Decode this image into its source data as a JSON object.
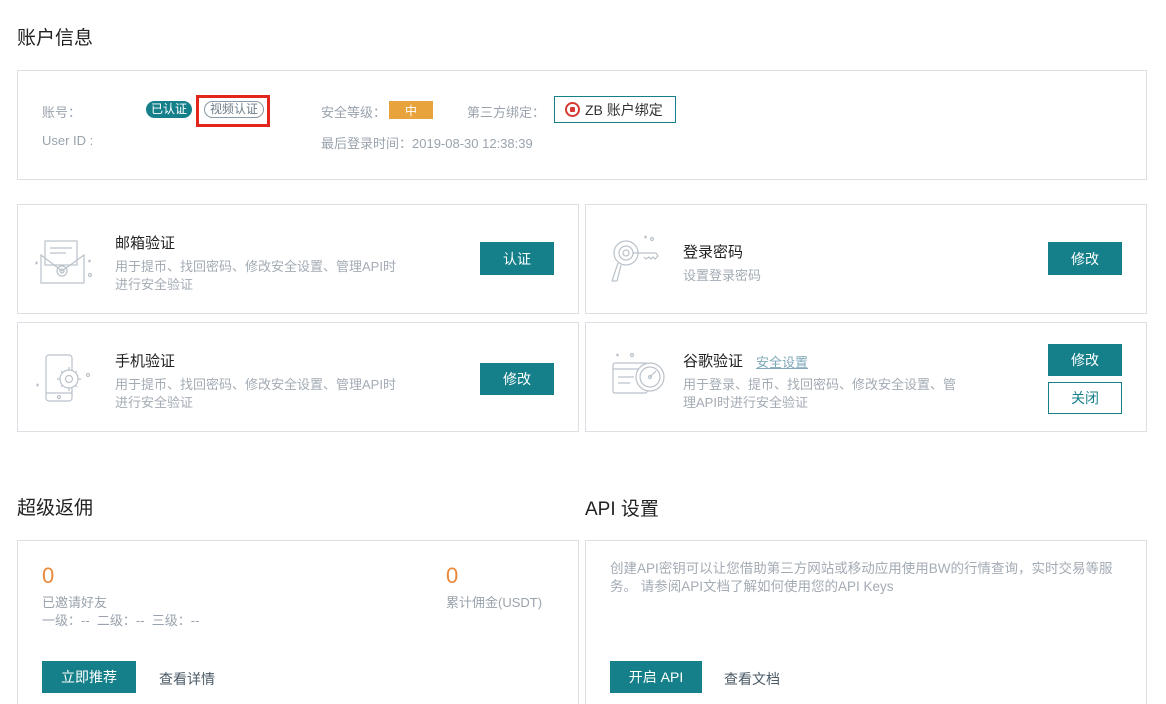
{
  "account_section": {
    "title": "账户信息"
  },
  "account": {
    "account_label": "账号：",
    "account_value": "",
    "verified_badge": "已认证",
    "video_badge": "视频认证",
    "userid_label": "User ID :",
    "userid_value": "",
    "security_label": "安全等级：",
    "security_level": "中",
    "third_party_label": "第三方绑定：",
    "zb_bind_label": "ZB 账户绑定",
    "last_login": "最后登录时间：2019-08-30 12:38:39"
  },
  "email_card": {
    "title": "邮箱验证",
    "desc_line1": "用于提币、找回密码、修改安全设置、管理API时",
    "desc_line2": "进行安全验证",
    "button": "认证"
  },
  "password_card": {
    "title": "登录密码",
    "desc": "设置登录密码",
    "button": "修改"
  },
  "phone_card": {
    "title": "手机验证",
    "desc_line1": "用于提币、找回密码、修改安全设置、管理API时",
    "desc_line2": "进行安全验证",
    "button": "修改"
  },
  "google_card": {
    "title": "谷歌验证",
    "link": "安全设置",
    "desc_line1": "用于登录、提币、找回密码、修改安全设置、管",
    "desc_line2": "理API时进行安全验证",
    "button_modify": "修改",
    "button_close": "关闭"
  },
  "rebate_section": {
    "title": "超级返佣"
  },
  "rebate": {
    "invited_count": "0",
    "invited_label": "已邀请好友",
    "levels": "一级：--  二级：--  三级：--",
    "commission": "0",
    "commission_label": "累计佣金(USDT)",
    "recommend_button": "立即推荐",
    "details_link": "查看详情"
  },
  "api_section": {
    "title": "API 设置"
  },
  "api": {
    "desc_line1": "创建API密钥可以让您借助第三方网站或移动应用使用BW的行情查询，实时交易等服",
    "desc_line2": "务。 请参阅API文档了解如何使用您的API Keys",
    "enable_button": "开启 API",
    "docs_link": "查看文档"
  }
}
